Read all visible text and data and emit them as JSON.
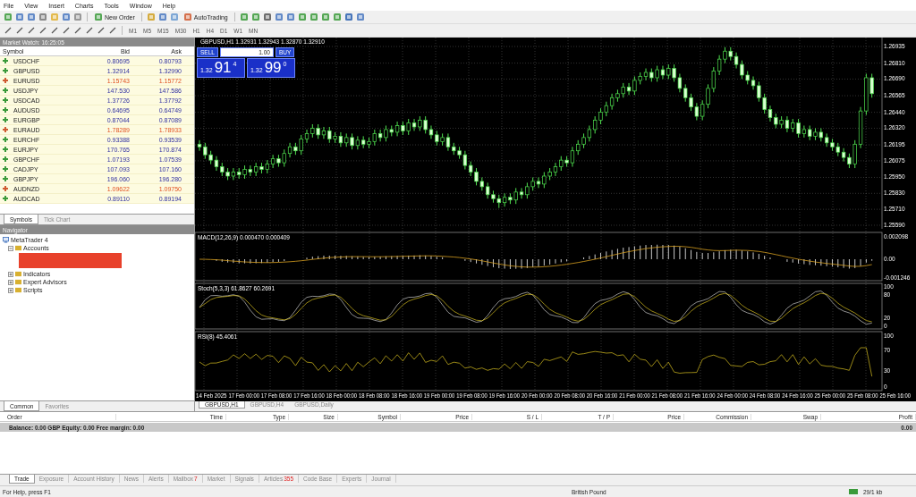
{
  "menu": [
    "File",
    "View",
    "Insert",
    "Charts",
    "Tools",
    "Window",
    "Help"
  ],
  "toolbar": {
    "new_order": "New Order",
    "auto_trading": "AutoTrading",
    "timeframes": [
      "M1",
      "M5",
      "M15",
      "M30",
      "H1",
      "H4",
      "D1",
      "W1",
      "MN"
    ]
  },
  "market_watch": {
    "title": "Market Watch: 16:25:05",
    "columns": [
      "Symbol",
      "Bid",
      "Ask"
    ],
    "rows": [
      {
        "symbol": "USDCHF",
        "bid": "0.80695",
        "ask": "0.80793",
        "up": true
      },
      {
        "symbol": "GBPUSD",
        "bid": "1.32914",
        "ask": "1.32990",
        "up": true
      },
      {
        "symbol": "EURUSD",
        "bid": "1.15743",
        "ask": "1.15772",
        "up": false
      },
      {
        "symbol": "USDJPY",
        "bid": "147.530",
        "ask": "147.586",
        "up": true
      },
      {
        "symbol": "USDCAD",
        "bid": "1.37726",
        "ask": "1.37792",
        "up": true
      },
      {
        "symbol": "AUDUSD",
        "bid": "0.64695",
        "ask": "0.64749",
        "up": true
      },
      {
        "symbol": "EURGBP",
        "bid": "0.87044",
        "ask": "0.87089",
        "up": true
      },
      {
        "symbol": "EURAUD",
        "bid": "1.78289",
        "ask": "1.78933",
        "up": false
      },
      {
        "symbol": "EURCHF",
        "bid": "0.93388",
        "ask": "0.93539",
        "up": true
      },
      {
        "symbol": "EURJPY",
        "bid": "170.765",
        "ask": "170.874",
        "up": true
      },
      {
        "symbol": "GBPCHF",
        "bid": "1.07193",
        "ask": "1.07539",
        "up": true
      },
      {
        "symbol": "CADJPY",
        "bid": "107.093",
        "ask": "107.160",
        "up": true
      },
      {
        "symbol": "GBPJPY",
        "bid": "196.060",
        "ask": "196.280",
        "up": true
      },
      {
        "symbol": "AUDNZD",
        "bid": "1.09622",
        "ask": "1.09750",
        "up": false
      },
      {
        "symbol": "AUDCAD",
        "bid": "0.89110",
        "ask": "0.89194",
        "up": true
      }
    ],
    "tabs": [
      {
        "label": "Symbols",
        "selected": true
      },
      {
        "label": "Tick Chart",
        "selected": false
      }
    ]
  },
  "navigator": {
    "title": "Navigator",
    "tree": [
      {
        "label": "MetaTrader 4",
        "children": [
          {
            "label": "Accounts",
            "expanded": true,
            "redacted": true
          },
          {
            "label": "Indicators",
            "expanded": false
          },
          {
            "label": "Expert Advisors",
            "expanded": false
          },
          {
            "label": "Scripts",
            "expanded": false
          }
        ]
      }
    ],
    "tabs": [
      {
        "label": "Common",
        "selected": true
      },
      {
        "label": "Favorites",
        "selected": false
      }
    ]
  },
  "chart": {
    "header": "GBPUSD,H1  1.32931 1.32943 1.32870 1.32910",
    "one_click": {
      "sell": "SELL",
      "lot": "1.00",
      "buy": "BUY",
      "sell_price": {
        "prefix": "1.32",
        "big": "91",
        "sup": "4"
      },
      "buy_price": {
        "prefix": "1.32",
        "big": "99",
        "sup": "0"
      }
    },
    "chart_data": {
      "type": "candlestick",
      "grid": true,
      "ylim": [
        1.25563,
        1.26989
      ],
      "yticks": [
        {
          "value": 1.26935,
          "label": "1.26935"
        },
        {
          "value": 1.2681,
          "label": "1.26810"
        },
        {
          "value": 1.2669,
          "label": "1.26690"
        },
        {
          "value": 1.26565,
          "label": "1.26565"
        },
        {
          "value": 1.2644,
          "label": "1.26440"
        },
        {
          "value": 1.2632,
          "label": "1.26320"
        },
        {
          "value": 1.26195,
          "label": "1.26195"
        },
        {
          "value": 1.26075,
          "label": "1.26075"
        },
        {
          "value": 1.2595,
          "label": "1.25950"
        },
        {
          "value": 1.2583,
          "label": "1.25830"
        },
        {
          "value": 1.2571,
          "label": "1.25710"
        },
        {
          "value": 1.2559,
          "label": "1.25590"
        }
      ],
      "ohlc": [
        [
          1.262,
          1.2623,
          1.2615,
          1.2618
        ],
        [
          1.2618,
          1.2621,
          1.2609,
          1.2612
        ],
        [
          1.2612,
          1.2615,
          1.2605,
          1.2608
        ],
        [
          1.2608,
          1.2611,
          1.26,
          1.2603
        ],
        [
          1.2603,
          1.2606,
          1.2596,
          1.2599
        ],
        [
          1.2599,
          1.2602,
          1.2593,
          1.2596
        ],
        [
          1.2596,
          1.2602,
          1.2593,
          1.2599
        ],
        [
          1.2599,
          1.2602,
          1.2594,
          1.2597
        ],
        [
          1.2597,
          1.2604,
          1.2594,
          1.2601
        ],
        [
          1.2601,
          1.2604,
          1.2596,
          1.2599
        ],
        [
          1.2599,
          1.2606,
          1.2596,
          1.2603
        ],
        [
          1.2603,
          1.2606,
          1.2598,
          1.2601
        ],
        [
          1.2601,
          1.2608,
          1.2598,
          1.2605
        ],
        [
          1.2605,
          1.2612,
          1.2602,
          1.2609
        ],
        [
          1.2609,
          1.2612,
          1.2603,
          1.2606
        ],
        [
          1.2606,
          1.2616,
          1.2603,
          1.2613
        ],
        [
          1.2613,
          1.2621,
          1.261,
          1.2618
        ],
        [
          1.2618,
          1.2621,
          1.2612,
          1.2615
        ],
        [
          1.2615,
          1.2627,
          1.2612,
          1.2624
        ],
        [
          1.2624,
          1.2631,
          1.2621,
          1.2628
        ],
        [
          1.2628,
          1.2635,
          1.2625,
          1.2632
        ],
        [
          1.2632,
          1.2635,
          1.2624,
          1.2627
        ],
        [
          1.2627,
          1.2633,
          1.2624,
          1.263
        ],
        [
          1.263,
          1.2633,
          1.2621,
          1.2624
        ],
        [
          1.2624,
          1.2629,
          1.2621,
          1.2626
        ],
        [
          1.2626,
          1.2629,
          1.2618,
          1.2621
        ],
        [
          1.2621,
          1.2628,
          1.2618,
          1.2625
        ],
        [
          1.2625,
          1.2628,
          1.2616,
          1.2619
        ],
        [
          1.2619,
          1.2626,
          1.2616,
          1.2623
        ],
        [
          1.2623,
          1.2626,
          1.2617,
          1.262
        ],
        [
          1.262,
          1.2625,
          1.2617,
          1.2622
        ],
        [
          1.2622,
          1.2631,
          1.2619,
          1.2628
        ],
        [
          1.2628,
          1.2631,
          1.2622,
          1.2625
        ],
        [
          1.2625,
          1.2634,
          1.2622,
          1.2631
        ],
        [
          1.2631,
          1.2634,
          1.2626,
          1.2629
        ],
        [
          1.2629,
          1.2637,
          1.2626,
          1.2634
        ],
        [
          1.2634,
          1.2637,
          1.2627,
          1.263
        ],
        [
          1.263,
          1.2639,
          1.2627,
          1.2636
        ],
        [
          1.2636,
          1.2639,
          1.263,
          1.2633
        ],
        [
          1.2633,
          1.2641,
          1.263,
          1.2638
        ],
        [
          1.2638,
          1.2641,
          1.2628,
          1.2631
        ],
        [
          1.2631,
          1.2634,
          1.2624,
          1.2627
        ],
        [
          1.2627,
          1.263,
          1.2619,
          1.2622
        ],
        [
          1.2622,
          1.2628,
          1.2619,
          1.2625
        ],
        [
          1.2625,
          1.2628,
          1.2615,
          1.2618
        ],
        [
          1.2618,
          1.2621,
          1.2612,
          1.2615
        ],
        [
          1.2615,
          1.2618,
          1.2609,
          1.2612
        ],
        [
          1.2612,
          1.2615,
          1.2601,
          1.2604
        ],
        [
          1.2604,
          1.2607,
          1.2596,
          1.2599
        ],
        [
          1.2599,
          1.2602,
          1.2589,
          1.2592
        ],
        [
          1.2592,
          1.2595,
          1.2585,
          1.2588
        ],
        [
          1.2588,
          1.2591,
          1.2579,
          1.2582
        ],
        [
          1.2582,
          1.2585,
          1.2576,
          1.2579
        ],
        [
          1.2579,
          1.2582,
          1.2572,
          1.2576
        ],
        [
          1.2576,
          1.2583,
          1.2573,
          1.258
        ],
        [
          1.258,
          1.2583,
          1.2575,
          1.2578
        ],
        [
          1.2578,
          1.2587,
          1.2575,
          1.2584
        ],
        [
          1.2584,
          1.2587,
          1.2579,
          1.2582
        ],
        [
          1.2582,
          1.2591,
          1.2579,
          1.2588
        ],
        [
          1.2588,
          1.2595,
          1.2585,
          1.2592
        ],
        [
          1.2592,
          1.2595,
          1.2587,
          1.259
        ],
        [
          1.259,
          1.2599,
          1.2587,
          1.2596
        ],
        [
          1.2596,
          1.2602,
          1.2593,
          1.2599
        ],
        [
          1.2599,
          1.2606,
          1.2596,
          1.2603
        ],
        [
          1.2603,
          1.2611,
          1.26,
          1.2608
        ],
        [
          1.2608,
          1.2611,
          1.2603,
          1.2606
        ],
        [
          1.2606,
          1.2618,
          1.2603,
          1.2615
        ],
        [
          1.2615,
          1.2623,
          1.2612,
          1.262
        ],
        [
          1.262,
          1.2628,
          1.2617,
          1.2625
        ],
        [
          1.2625,
          1.2634,
          1.2622,
          1.2631
        ],
        [
          1.2631,
          1.2641,
          1.2628,
          1.2638
        ],
        [
          1.2638,
          1.2647,
          1.2635,
          1.2644
        ],
        [
          1.2644,
          1.2652,
          1.2641,
          1.2649
        ],
        [
          1.2649,
          1.2658,
          1.2646,
          1.2655
        ],
        [
          1.2655,
          1.2661,
          1.2652,
          1.2658
        ],
        [
          1.2658,
          1.2666,
          1.2655,
          1.2663
        ],
        [
          1.2663,
          1.2666,
          1.2657,
          1.266
        ],
        [
          1.266,
          1.2671,
          1.2657,
          1.2668
        ],
        [
          1.2668,
          1.2674,
          1.2665,
          1.2671
        ],
        [
          1.2671,
          1.2677,
          1.2668,
          1.2674
        ],
        [
          1.2674,
          1.2677,
          1.2667,
          1.267
        ],
        [
          1.267,
          1.2679,
          1.2667,
          1.2676
        ],
        [
          1.2676,
          1.2679,
          1.2669,
          1.2672
        ],
        [
          1.2672,
          1.268,
          1.2669,
          1.2677
        ],
        [
          1.2677,
          1.268,
          1.2667,
          1.267
        ],
        [
          1.267,
          1.2673,
          1.2659,
          1.2662
        ],
        [
          1.2662,
          1.2665,
          1.2652,
          1.2655
        ],
        [
          1.2655,
          1.2658,
          1.2645,
          1.2648
        ],
        [
          1.2648,
          1.2651,
          1.2638,
          1.2641
        ],
        [
          1.2641,
          1.2653,
          1.2638,
          1.265
        ],
        [
          1.265,
          1.2665,
          1.2647,
          1.2662
        ],
        [
          1.2662,
          1.2678,
          1.2659,
          1.2675
        ],
        [
          1.2675,
          1.2687,
          1.2672,
          1.2684
        ],
        [
          1.2684,
          1.2693,
          1.2681,
          1.269
        ],
        [
          1.269,
          1.2693,
          1.2683,
          1.2686
        ],
        [
          1.2686,
          1.2689,
          1.2677,
          1.268
        ],
        [
          1.268,
          1.2683,
          1.2669,
          1.2672
        ],
        [
          1.2672,
          1.2675,
          1.2665,
          1.2668
        ],
        [
          1.2668,
          1.2671,
          1.2661,
          1.2664
        ],
        [
          1.2664,
          1.2667,
          1.2652,
          1.2655
        ],
        [
          1.2655,
          1.2658,
          1.2643,
          1.2646
        ],
        [
          1.2646,
          1.2649,
          1.2637,
          1.264
        ],
        [
          1.264,
          1.2643,
          1.2632,
          1.2635
        ],
        [
          1.2635,
          1.2641,
          1.2632,
          1.2638
        ],
        [
          1.2638,
          1.2641,
          1.2629,
          1.2632
        ],
        [
          1.2632,
          1.2639,
          1.2629,
          1.2636
        ],
        [
          1.2636,
          1.2639,
          1.2625,
          1.2628
        ],
        [
          1.2628,
          1.2634,
          1.2625,
          1.2631
        ],
        [
          1.2631,
          1.2634,
          1.2623,
          1.2626
        ],
        [
          1.2626,
          1.2632,
          1.2623,
          1.2629
        ],
        [
          1.2629,
          1.2632,
          1.2622,
          1.2625
        ],
        [
          1.2625,
          1.2628,
          1.2618,
          1.2621
        ],
        [
          1.2621,
          1.2624,
          1.2615,
          1.2618
        ],
        [
          1.2618,
          1.2621,
          1.2611,
          1.2614
        ],
        [
          1.2614,
          1.2617,
          1.2607,
          1.261
        ],
        [
          1.261,
          1.2613,
          1.2602,
          1.2605
        ],
        [
          1.2605,
          1.2623,
          1.2602,
          1.262
        ],
        [
          1.262,
          1.2648,
          1.2617,
          1.2645
        ],
        [
          1.2645,
          1.2673,
          1.2642,
          1.267
        ],
        [
          1.267,
          1.2673,
          1.2655,
          1.2658
        ]
      ]
    },
    "macd": {
      "label": "MACD(12,26,9) 0.000470 0.000409",
      "axis": [
        "0.002098",
        "0.00",
        "-0.001246"
      ]
    },
    "stoch": {
      "label": "Stoch(5,3,3) 61.8627 60.2691",
      "axis": [
        "100",
        "80",
        "20",
        "0"
      ]
    },
    "rsi": {
      "label": "RSI(8) 45.4061",
      "axis": [
        "100",
        "70",
        "30",
        "0"
      ]
    },
    "time_labels": [
      "14 Feb 2025",
      "17 Feb 00:00",
      "17 Feb 08:00",
      "17 Feb 16:00",
      "18 Feb 00:00",
      "18 Feb 08:00",
      "18 Feb 16:00",
      "19 Feb 00:00",
      "19 Feb 08:00",
      "19 Feb 16:00",
      "20 Feb 00:00",
      "20 Feb 08:00",
      "20 Feb 16:00",
      "21 Feb 00:00",
      "21 Feb 08:00",
      "21 Feb 16:00",
      "24 Feb 00:00",
      "24 Feb 08:00",
      "24 Feb 16:00",
      "25 Feb 00:00",
      "25 Feb 08:00",
      "25 Feb 16:00"
    ],
    "tabs": [
      {
        "label": "GBPUSD,H1",
        "selected": true
      },
      {
        "label": "GBPUSD,H4",
        "selected": false
      },
      {
        "label": "GBPUSD,Daily",
        "selected": false
      }
    ]
  },
  "terminal": {
    "columns": [
      "Order",
      "Time",
      "Type",
      "Size",
      "Symbol",
      "Price",
      "S / L",
      "T / P",
      "Price",
      "Commission",
      "Swap",
      "Profit"
    ],
    "balance": "Balance: 0.00 GBP  Equity: 0.00  Free margin: 0.00",
    "profit": "0.00",
    "tabs": [
      {
        "label": "Trade",
        "selected": true
      },
      {
        "label": "Exposure",
        "selected": false
      },
      {
        "label": "Account History",
        "selected": false
      },
      {
        "label": "News",
        "selected": false
      },
      {
        "label": "Alerts",
        "selected": false
      },
      {
        "label": "Mailbox",
        "badge": "7",
        "selected": false
      },
      {
        "label": "Market",
        "selected": false
      },
      {
        "label": "Signals",
        "selected": false
      },
      {
        "label": "Articles",
        "badge": "355",
        "selected": false
      },
      {
        "label": "Code Base",
        "selected": false
      },
      {
        "label": "Experts",
        "selected": false
      },
      {
        "label": "Journal",
        "selected": false
      }
    ]
  },
  "status_bar": {
    "help": "For Help, press F1",
    "currency": "British Pound",
    "traffic": "29/1 kb"
  }
}
